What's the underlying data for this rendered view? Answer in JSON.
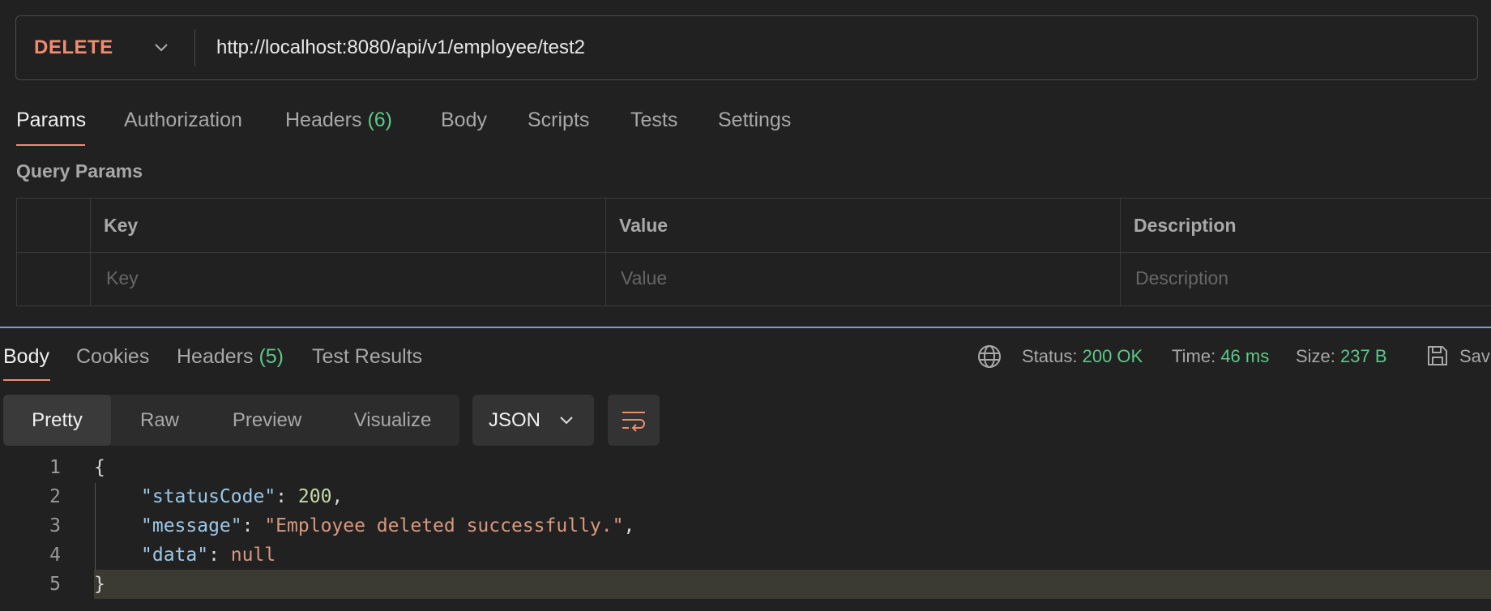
{
  "request": {
    "method": "DELETE",
    "url": "http://localhost:8080/api/v1/employee/test2"
  },
  "request_tabs": {
    "params": "Params",
    "authorization": "Authorization",
    "headers": "Headers",
    "headers_count": "(6)",
    "body": "Body",
    "scripts": "Scripts",
    "tests": "Tests",
    "settings": "Settings"
  },
  "query_params": {
    "title": "Query Params",
    "columns": {
      "key": "Key",
      "value": "Value",
      "description": "Description"
    },
    "placeholders": {
      "key": "Key",
      "value": "Value",
      "description": "Description"
    }
  },
  "response_tabs": {
    "body": "Body",
    "cookies": "Cookies",
    "headers": "Headers",
    "headers_count": "(5)",
    "test_results": "Test Results"
  },
  "response_status": {
    "status_label": "Status:",
    "status_value": "200 OK",
    "time_label": "Time:",
    "time_value": "46 ms",
    "size_label": "Size:",
    "size_value": "237 B",
    "save_label": "Sav"
  },
  "view_modes": {
    "pretty": "Pretty",
    "raw": "Raw",
    "preview": "Preview",
    "visualize": "Visualize",
    "format": "JSON"
  },
  "code": {
    "line_numbers": [
      "1",
      "2",
      "3",
      "4",
      "5"
    ],
    "open_brace": "{",
    "close_brace": "}",
    "lines": [
      {
        "key": "\"statusCode\"",
        "sep": ": ",
        "value": "200",
        "trail": ","
      },
      {
        "key": "\"message\"",
        "sep": ": ",
        "value": "\"Employee deleted successfully.\"",
        "trail": ","
      },
      {
        "key": "\"data\"",
        "sep": ": ",
        "value": "null",
        "trail": ""
      }
    ]
  },
  "colors": {
    "accent": "#f08c70",
    "success": "#5cc98a",
    "divider": "#7b9bd6"
  }
}
